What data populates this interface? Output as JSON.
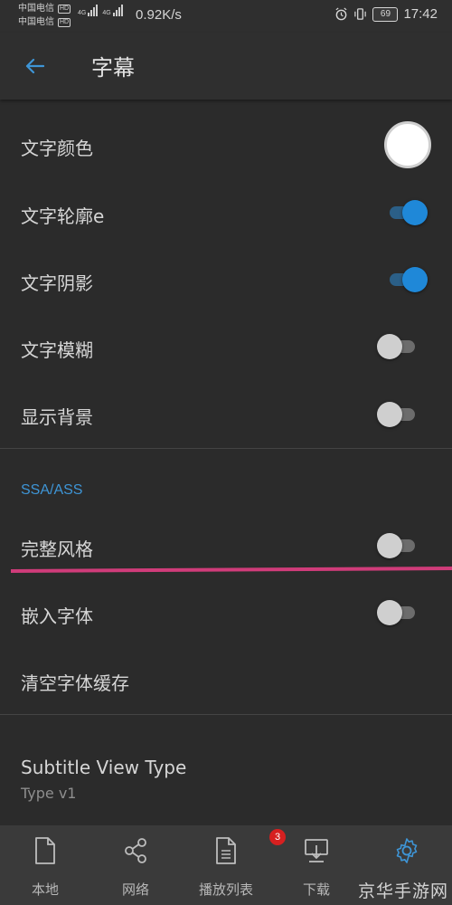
{
  "status_bar": {
    "carrier_1": "中国电信",
    "carrier_2": "中国电信",
    "hd_label": "HD",
    "signal_label": "4G",
    "network_speed": "0.92K/s",
    "battery": "69",
    "time": "17:42"
  },
  "app_bar": {
    "title": "字幕"
  },
  "settings": {
    "text_color_label": "文字颜色",
    "text_color_value": "#ffffff",
    "text_outline_label": "文字轮廓e",
    "text_outline_on": true,
    "text_shadow_label": "文字阴影",
    "text_shadow_on": true,
    "text_blur_label": "文字模糊",
    "text_blur_on": false,
    "show_background_label": "显示背景",
    "show_background_on": false,
    "ssa_section_title": "SSA/ASS",
    "full_style_label": "完整风格",
    "full_style_on": false,
    "embedded_fonts_label": "嵌入字体",
    "embedded_fonts_on": false,
    "clear_font_cache_label": "清空字体缓存",
    "subtitle_view_type_label": "Subtitle View Type",
    "subtitle_view_type_value": "Type v1"
  },
  "bottom_nav": {
    "items": [
      {
        "label": "本地",
        "icon": "file-icon"
      },
      {
        "label": "网络",
        "icon": "share-icon"
      },
      {
        "label": "播放列表",
        "icon": "playlist-icon"
      },
      {
        "label": "下载",
        "icon": "download-icon"
      },
      {
        "label": "",
        "icon": "gear-icon"
      }
    ],
    "active_index": 4,
    "playlist_badge": "3"
  },
  "watermark": "京华手游网",
  "colors": {
    "accent": "#3e95d6",
    "toggle_on": "#1f88d8",
    "badge": "#d62020",
    "annotation_line": "#d03c7a"
  }
}
